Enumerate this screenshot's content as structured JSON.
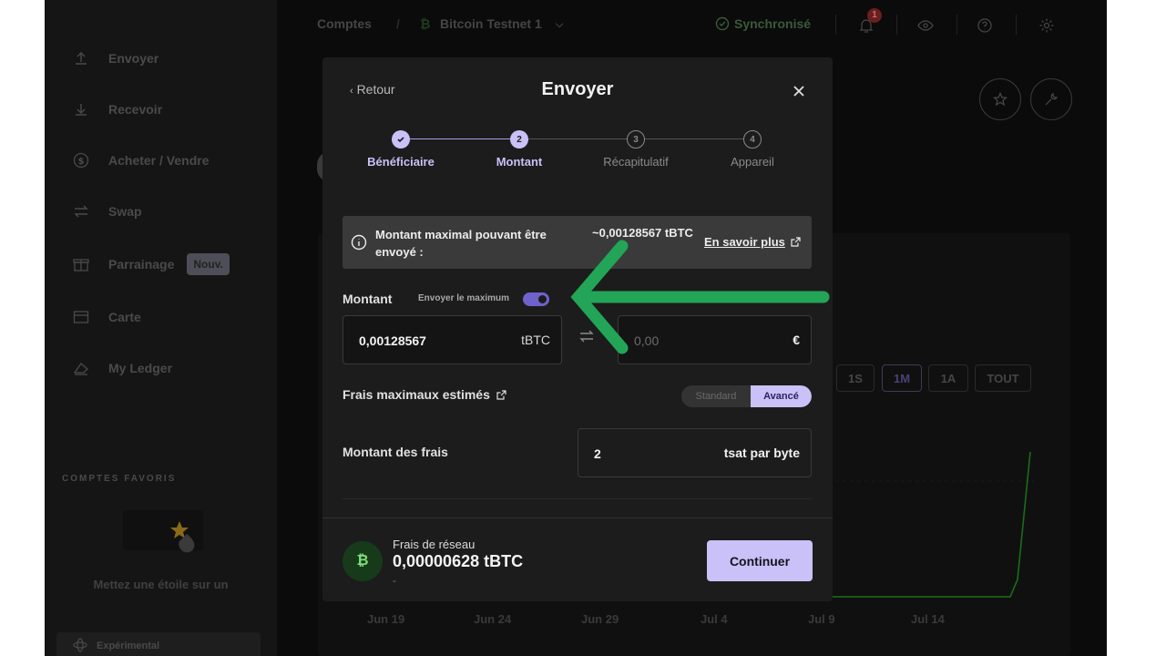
{
  "sidebar": {
    "items": [
      {
        "label": "Envoyer",
        "icon": "arrow-up-icon"
      },
      {
        "label": "Recevoir",
        "icon": "arrow-down-icon"
      },
      {
        "label": "Acheter / Vendre",
        "icon": "dollar-circle-icon"
      },
      {
        "label": "Swap",
        "icon": "swap-icon"
      },
      {
        "label": "Parrainage",
        "icon": "gift-icon",
        "badge": "Nouv."
      },
      {
        "label": "Carte",
        "icon": "card-icon"
      },
      {
        "label": "My Ledger",
        "icon": "ledger-icon"
      }
    ],
    "favorites_heading": "COMPTES FAVORIS",
    "favorites_hint": "Mettez une étoile sur un",
    "experimental_label": "Expérimental"
  },
  "topbar": {
    "breadcrumb_root": "Comptes",
    "account_name": "Bitcoin Testnet 1",
    "sync_status": "Synchronisé",
    "notification_count": "1"
  },
  "chart": {
    "ranges": [
      "1S",
      "1M",
      "1A",
      "TOUT"
    ],
    "active_range": "1M",
    "dates": [
      "Jun 19",
      "Jun 24",
      "Jun 29",
      "Jul 4",
      "Jul 9",
      "Jul 14"
    ]
  },
  "modal": {
    "back_label": "Retour",
    "title": "Envoyer",
    "steps": [
      {
        "label": "Bénéficiaire",
        "number": "1",
        "state": "done"
      },
      {
        "label": "Montant",
        "number": "2",
        "state": "current"
      },
      {
        "label": "Récapitulatif",
        "number": "3",
        "state": "pending"
      },
      {
        "label": "Appareil",
        "number": "4",
        "state": "pending"
      }
    ],
    "info": {
      "label": "Montant maximal pouvant être envoyé :",
      "value": "~0,00128567 tBTC",
      "learn_more": "En savoir plus"
    },
    "amount": {
      "label": "Montant",
      "send_max_label": "Envoyer le maximum",
      "send_max_on": true,
      "crypto_value": "0,00128567",
      "crypto_unit": "tBTC",
      "fiat_placeholder": "0,00",
      "fiat_unit": "€"
    },
    "fees": {
      "label": "Frais maximaux estimés",
      "mode_standard": "Standard",
      "mode_advanced": "Avancé",
      "amount_label": "Montant des frais",
      "amount_value": "2",
      "amount_unit": "tsat par byte"
    },
    "footer": {
      "network_fee_label": "Frais de réseau",
      "network_fee_value": "0,00000628 tBTC",
      "network_fee_sub": "-",
      "continue_label": "Continuer"
    }
  },
  "colors": {
    "accent": "#c9c1f7",
    "annotation_arrow": "#22a556",
    "bitcoin_green": "#7ee07a"
  }
}
